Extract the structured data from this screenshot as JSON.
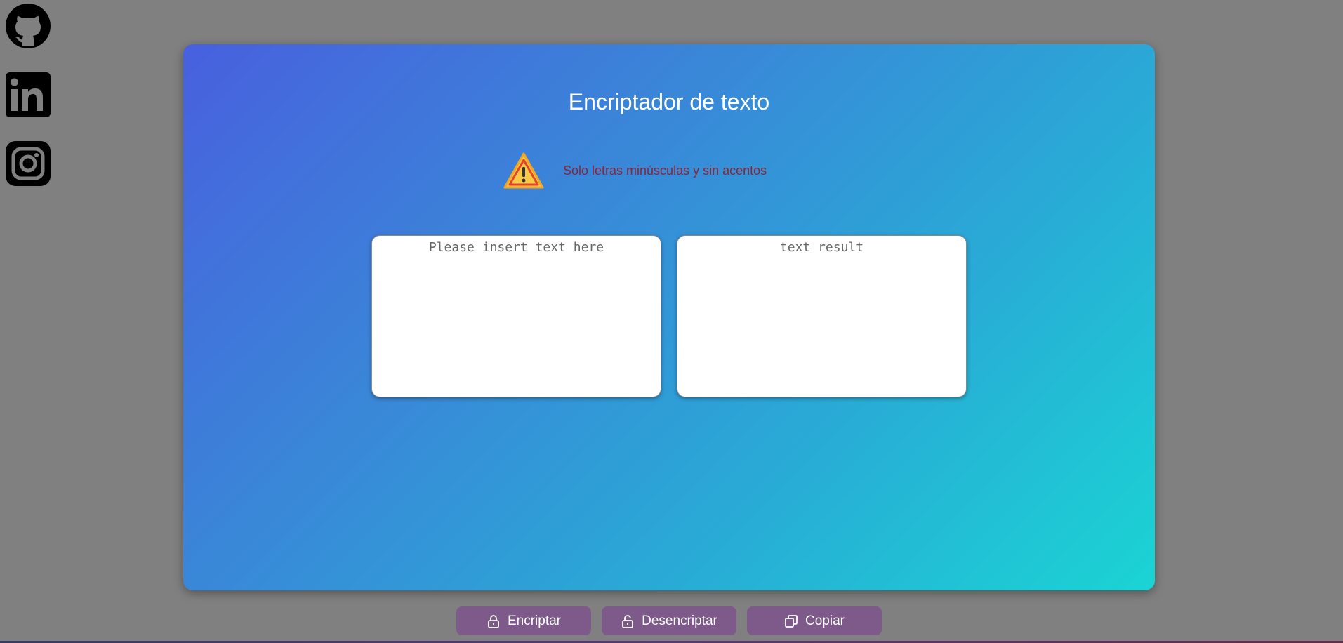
{
  "social": {
    "github_icon": "github-icon",
    "linkedin_icon": "linkedin-icon",
    "instagram_icon": "instagram-icon"
  },
  "card": {
    "title": "Encriptador de texto",
    "warning_icon": "warning-icon",
    "warning_text": "Solo letras minúsculas y sin acentos",
    "input": {
      "placeholder": "Please insert text here",
      "value": ""
    },
    "output": {
      "placeholder": "text result",
      "value": ""
    }
  },
  "buttons": {
    "encrypt": {
      "label": "Encriptar",
      "icon": "lock-icon"
    },
    "decrypt": {
      "label": "Desencriptar",
      "icon": "unlock-icon"
    },
    "copy": {
      "label": "Copiar",
      "icon": "copy-icon"
    }
  },
  "colors": {
    "background": "#808080",
    "card_gradient_start": "#4860de",
    "card_gradient_end": "#1ad4d4",
    "button": "#7d5a8a",
    "warning_text": "#8a2436"
  }
}
